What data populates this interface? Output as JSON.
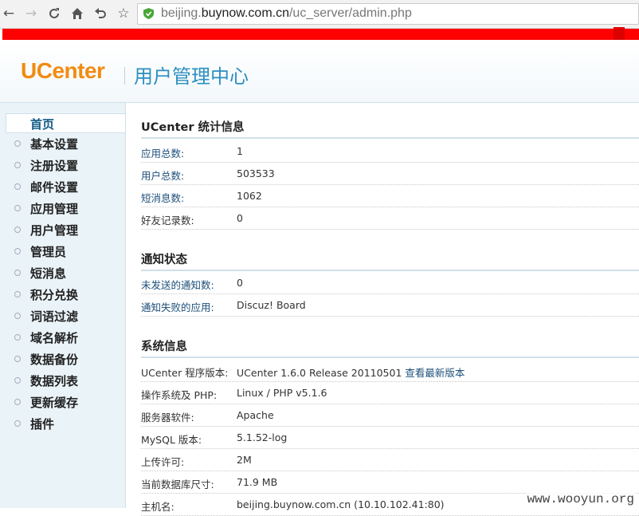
{
  "browser": {
    "url_host_prefix": "beijing.",
    "url_host_bold": "buynow.com.cn",
    "url_path": "/uc_server/admin.php"
  },
  "header": {
    "logo": "UCenter",
    "title": "用户管理中心"
  },
  "sidebar": {
    "items": [
      {
        "label": "首页",
        "active": true
      },
      {
        "label": "基本设置"
      },
      {
        "label": "注册设置"
      },
      {
        "label": "邮件设置"
      },
      {
        "label": "应用管理"
      },
      {
        "label": "用户管理"
      },
      {
        "label": "管理员"
      },
      {
        "label": "短消息"
      },
      {
        "label": "积分兑换"
      },
      {
        "label": "词语过滤"
      },
      {
        "label": "域名解析"
      },
      {
        "label": "数据备份"
      },
      {
        "label": "数据列表"
      },
      {
        "label": "更新缓存"
      },
      {
        "label": "插件"
      }
    ]
  },
  "stats": {
    "title": "UCenter 统计信息",
    "rows": [
      {
        "key": "应用总数:",
        "value": "1"
      },
      {
        "key": "用户总数:",
        "value": "503533"
      },
      {
        "key": "短消息数:",
        "value": "1062"
      },
      {
        "key": "好友记录数:",
        "value": "0"
      }
    ]
  },
  "notify": {
    "title": "通知状态",
    "rows": [
      {
        "key": "未发送的通知数:",
        "value": "0"
      },
      {
        "key": "通知失败的应用:",
        "value": "Discuz! Board"
      }
    ]
  },
  "system": {
    "title": "系统信息",
    "rows": [
      {
        "key": "UCenter 程序版本:",
        "value": "UCenter 1.6.0 Release 20110501",
        "link": "查看最新版本"
      },
      {
        "key": "操作系统及 PHP:",
        "value": "Linux / PHP v5.1.6"
      },
      {
        "key": "服务器软件:",
        "value": "Apache"
      },
      {
        "key": "MySQL 版本:",
        "value": "5.1.52-log"
      },
      {
        "key": "上传许可:",
        "value": "2M"
      },
      {
        "key": "当前数据库尺寸:",
        "value": "71.9 MB"
      },
      {
        "key": "主机名:",
        "value": "beijing.buynow.com.cn (10.10.102.41:80)"
      }
    ]
  },
  "watermark": "www.wooyun.org"
}
